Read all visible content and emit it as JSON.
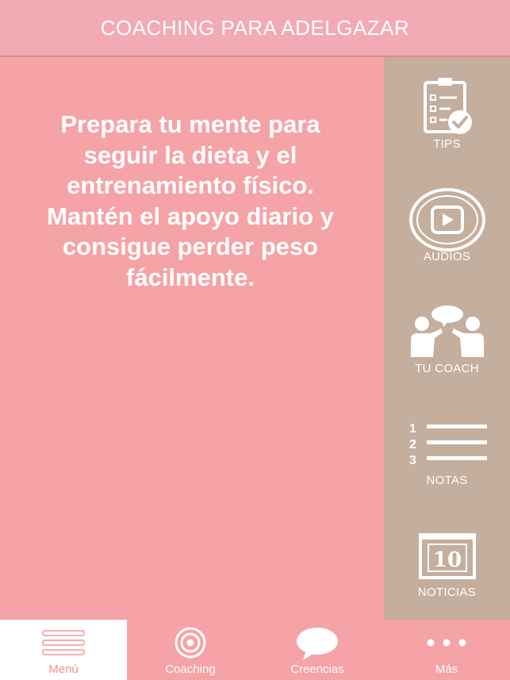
{
  "header": {
    "title": "COACHING PARA ADELGAZAR"
  },
  "main": {
    "intro_text": "Prepara tu mente para seguir la dieta y el entrenamiento físico. Mantén el apoyo diario y consigue perder peso fácilmente."
  },
  "sidebar": {
    "items": [
      {
        "label": "TIPS",
        "icon": "clipboard-check-icon"
      },
      {
        "label": "AUDIOS",
        "icon": "play-circle-icon"
      },
      {
        "label": "TU COACH",
        "icon": "people-talking-icon"
      },
      {
        "label": "NOTAS",
        "icon": "numbered-list-icon",
        "icon_numbers": [
          "1",
          "2",
          "3"
        ]
      },
      {
        "label": "NOTICIAS",
        "icon": "calendar-icon",
        "icon_number": "10"
      }
    ]
  },
  "tabbar": {
    "active": "Menú",
    "tabs": [
      {
        "label": "Menú",
        "icon": "menu-icon"
      },
      {
        "label": "Coaching",
        "icon": "target-icon"
      },
      {
        "label": "Creencias",
        "icon": "chat-bubble-icon"
      },
      {
        "label": "Más",
        "icon": "more-dots-icon"
      }
    ]
  },
  "colors": {
    "background": "#f5a3a6",
    "header": "#f2aab4",
    "sidebar": "#c4ae9d",
    "text": "#ffffff",
    "active_tab_text": "#f08e96"
  }
}
